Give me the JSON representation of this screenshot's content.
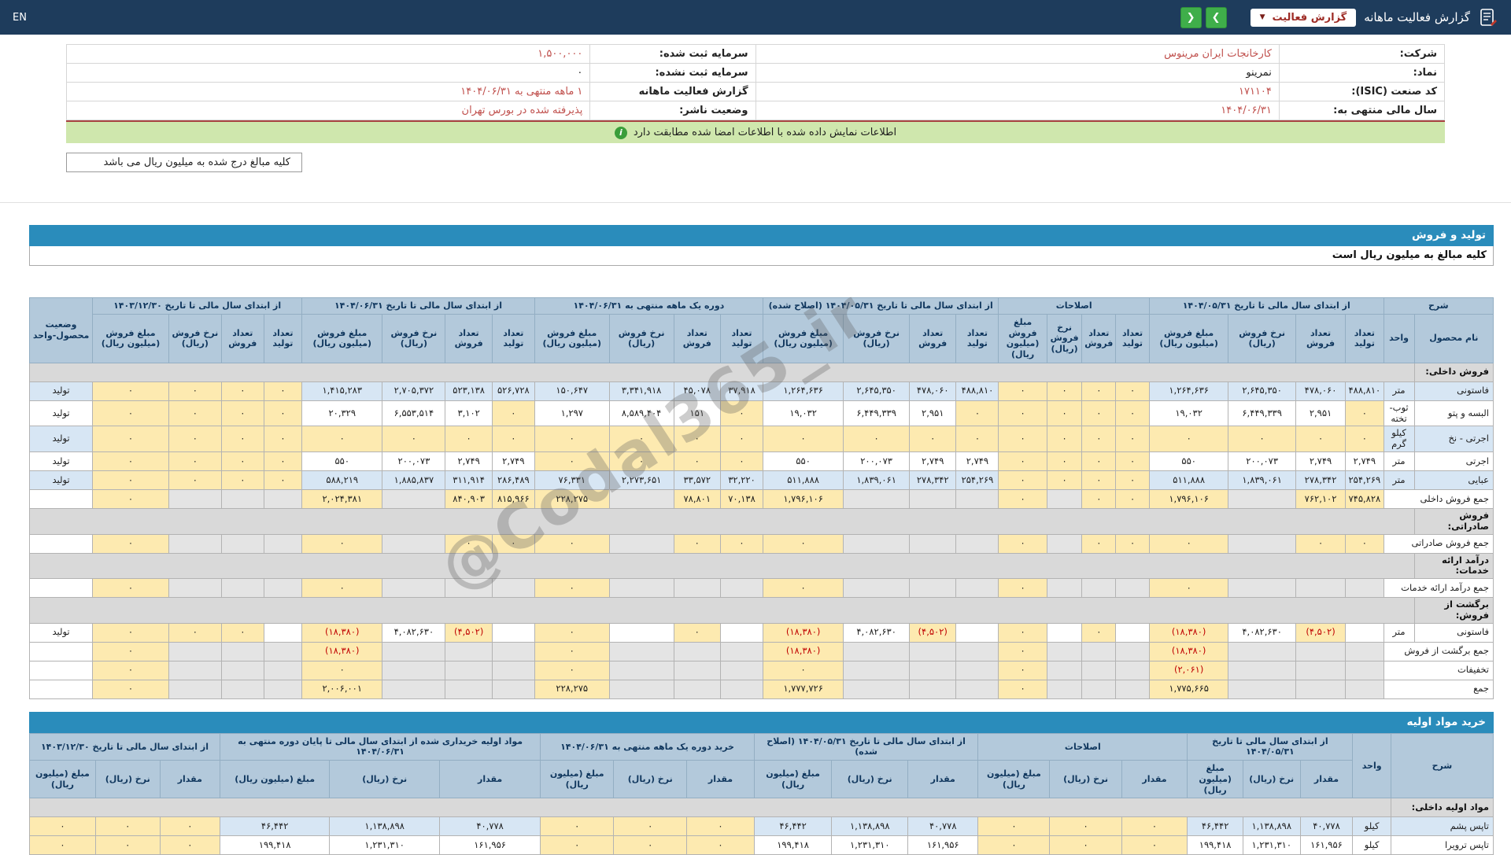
{
  "topbar": {
    "title": "گزارش فعالیت ماهانه",
    "report_select_label": "گزارش فعالیت",
    "caret_icon": "▼",
    "nav_next_icon": "❯",
    "nav_prev_icon": "❮",
    "en_label": "EN"
  },
  "company": {
    "rows": [
      {
        "label_r": "شرکت:",
        "value_r": "کارخانجات ایران مرینوس",
        "label_l": "سرمایه ثبت شده:",
        "value_l": "۱,۵۰۰,۰۰۰"
      },
      {
        "label_r": "نماد:",
        "value_r": "نمرینو",
        "label_l": "سرمایه ثبت نشده:",
        "value_l": "۰"
      },
      {
        "label_r": "کد صنعت (ISIC):",
        "value_r": "۱۷۱۱۰۴",
        "label_l": "گزارش فعالیت ماهانه",
        "value_l": "۱ ماهه منتهی به ۱۴۰۴/۰۶/۳۱"
      },
      {
        "label_r": "سال مالی منتهی به:",
        "value_r": "۱۴۰۴/۰۶/۳۱",
        "label_l": "وضعیت ناشر:",
        "value_l": "پذیرفته شده در بورس تهران"
      }
    ]
  },
  "verify": {
    "text": "اطلاعات نمایش داده شده با اطلاعات امضا شده مطابقت دارد",
    "icon": "i"
  },
  "amounts_note": "کلیه مبالغ درج شده به میلیون ریال می باشد",
  "watermark": "@Codal365_ir",
  "sales": {
    "title": "تولید و فروش",
    "note": "کلیه مبالغ به میلیون ریال است",
    "desc_header": "شرح",
    "name_header": "نام محصول",
    "unit_header": "واحد",
    "status_header": "وضعیت محصول-واحد",
    "groups": [
      "از ابتدای سال مالی تا تاریخ ۱۴۰۴/۰۵/۳۱",
      "اصلاحات",
      "از ابتدای سال مالی تا تاریخ ۱۴۰۴/۰۵/۳۱ (اصلاح شده)",
      "دوره یک ماهه منتهی به ۱۴۰۴/۰۶/۳۱",
      "از ابتدای سال مالی تا تاریخ ۱۴۰۴/۰۶/۳۱",
      "از ابتدای سال مالی تا تاریخ ۱۴۰۳/۱۲/۳۰"
    ],
    "subcols": [
      "تعداد تولید",
      "تعداد فروش",
      "نرخ فروش (ریال)",
      "مبلغ فروش (میلیون ریال)"
    ],
    "rows": [
      {
        "type": "section",
        "name": "فروش داخلی:"
      },
      {
        "type": "data",
        "name": "فاستونی",
        "unit": "متر",
        "status": "تولید",
        "cells": [
          "۴۸۸,۸۱۰",
          "۴۷۸,۰۶۰",
          "۲,۶۴۵,۳۵۰",
          "۱,۲۶۴,۶۳۶",
          "۰",
          "۰",
          "۰",
          "۰",
          "۴۸۸,۸۱۰",
          "۴۷۸,۰۶۰",
          "۲,۶۴۵,۳۵۰",
          "۱,۲۶۴,۶۳۶",
          "۳۷,۹۱۸",
          "۴۵,۰۷۸",
          "۳,۳۴۱,۹۱۸",
          "۱۵۰,۶۴۷",
          "۵۲۶,۷۲۸",
          "۵۲۳,۱۳۸",
          "۲,۷۰۵,۳۷۲",
          "۱,۴۱۵,۲۸۳",
          "۰",
          "۰",
          "۰",
          "۰"
        ]
      },
      {
        "type": "data",
        "name": "البسه و پتو",
        "unit": "ثوب-تخته",
        "status": "تولید",
        "cells": [
          "۰",
          "۲,۹۵۱",
          "۶,۴۴۹,۳۳۹",
          "۱۹,۰۳۲",
          "۰",
          "۰",
          "۰",
          "۰",
          "۰",
          "۲,۹۵۱",
          "۶,۴۴۹,۳۳۹",
          "۱۹,۰۳۲",
          "۰",
          "۱۵۱",
          "۸,۵۸۹,۴۰۴",
          "۱,۲۹۷",
          "۰",
          "۳,۱۰۲",
          "۶,۵۵۳,۵۱۴",
          "۲۰,۳۲۹",
          "۰",
          "۰",
          "۰",
          "۰"
        ]
      },
      {
        "type": "data",
        "name": "اجرتی - نخ",
        "unit": "کیلو گرم",
        "status": "تولید",
        "cells": [
          "۰",
          "۰",
          "۰",
          "۰",
          "۰",
          "۰",
          "۰",
          "۰",
          "۰",
          "۰",
          "۰",
          "۰",
          "۰",
          "۰",
          "۰",
          "۰",
          "۰",
          "۰",
          "۰",
          "۰",
          "۰",
          "۰",
          "۰",
          "۰"
        ]
      },
      {
        "type": "data",
        "name": "اجرتی",
        "unit": "متر",
        "status": "تولید",
        "cells": [
          "۲,۷۴۹",
          "۲,۷۴۹",
          "۲۰۰,۰۷۳",
          "۵۵۰",
          "۰",
          "۰",
          "۰",
          "۰",
          "۲,۷۴۹",
          "۲,۷۴۹",
          "۲۰۰,۰۷۳",
          "۵۵۰",
          "۰",
          "۰",
          "۰",
          "۰",
          "۲,۷۴۹",
          "۲,۷۴۹",
          "۲۰۰,۰۷۳",
          "۵۵۰",
          "۰",
          "۰",
          "۰",
          "۰"
        ]
      },
      {
        "type": "data",
        "name": "عبایی",
        "unit": "متر",
        "status": "تولید",
        "cells": [
          "۲۵۴,۲۶۹",
          "۲۷۸,۳۴۲",
          "۱,۸۳۹,۰۶۱",
          "۵۱۱,۸۸۸",
          "۰",
          "۰",
          "۰",
          "۰",
          "۲۵۴,۲۶۹",
          "۲۷۸,۳۴۲",
          "۱,۸۳۹,۰۶۱",
          "۵۱۱,۸۸۸",
          "۳۲,۲۲۰",
          "۳۳,۵۷۲",
          "۲,۲۷۳,۶۵۱",
          "۷۶,۳۳۱",
          "۲۸۶,۴۸۹",
          "۳۱۱,۹۱۴",
          "۱,۸۸۵,۸۳۷",
          "۵۸۸,۲۱۹",
          "۰",
          "۰",
          "۰",
          "۰"
        ]
      },
      {
        "type": "sum",
        "name": "جمع فروش داخلی",
        "status": "",
        "cells": [
          "۷۴۵,۸۲۸",
          "۷۶۲,۱۰۲",
          "",
          "۱,۷۹۶,۱۰۶",
          "۰",
          "۰",
          "",
          "۰",
          "",
          "",
          "",
          "۱,۷۹۶,۱۰۶",
          "۷۰,۱۳۸",
          "۷۸,۸۰۱",
          "",
          "۲۲۸,۲۷۵",
          "۸۱۵,۹۶۶",
          "۸۴۰,۹۰۳",
          "",
          "۲,۰۲۴,۳۸۱",
          "",
          "",
          "",
          "۰"
        ]
      },
      {
        "type": "section",
        "name": "فروش صادراتی:"
      },
      {
        "type": "sum",
        "name": "جمع فروش صادراتی",
        "status": "",
        "cells": [
          "۰",
          "۰",
          "",
          "۰",
          "۰",
          "۰",
          "",
          "۰",
          "",
          "",
          "",
          "۰",
          "۰",
          "۰",
          "",
          "۰",
          "۰",
          "۰",
          "",
          "۰",
          "",
          "",
          "",
          "۰"
        ]
      },
      {
        "type": "section",
        "name": "درآمد ارائه خدمات:"
      },
      {
        "type": "sum",
        "name": "جمع درآمد ارائه خدمات",
        "status": "",
        "cells": [
          "",
          "",
          "",
          "۰",
          "",
          "",
          "",
          "۰",
          "",
          "",
          "",
          "۰",
          "",
          "",
          "",
          "۰",
          "",
          "",
          "",
          "۰",
          "",
          "",
          "",
          "۰"
        ]
      },
      {
        "type": "section",
        "name": "برگشت از فروش:"
      },
      {
        "type": "data",
        "name": "فاستونی",
        "unit": "متر",
        "status": "تولید",
        "cells": [
          "",
          "(۴,۵۰۲)",
          "۴,۰۸۲,۶۳۰",
          "(۱۸,۳۸۰)",
          "",
          "۰",
          "",
          "۰",
          "",
          "(۴,۵۰۲)",
          "۴,۰۸۲,۶۳۰",
          "(۱۸,۳۸۰)",
          "",
          "۰",
          "",
          "۰",
          "",
          "(۴,۵۰۲)",
          "۴,۰۸۲,۶۳۰",
          "(۱۸,۳۸۰)",
          "",
          "۰",
          "۰",
          "۰"
        ]
      },
      {
        "type": "sum",
        "name": "جمع برگشت از فروش",
        "status": "",
        "cells": [
          "",
          "",
          "",
          "(۱۸,۳۸۰)",
          "",
          "",
          "",
          "۰",
          "",
          "",
          "",
          "(۱۸,۳۸۰)",
          "",
          "",
          "",
          "۰",
          "",
          "",
          "",
          "(۱۸,۳۸۰)",
          "",
          "",
          "",
          "۰"
        ]
      },
      {
        "type": "sum",
        "name": "تخفیفات",
        "status": "",
        "cells": [
          "",
          "",
          "",
          "(۲,۰۶۱)",
          "",
          "",
          "",
          "۰",
          "",
          "",
          "",
          "۰",
          "",
          "",
          "",
          "۰",
          "",
          "",
          "",
          "۰",
          "",
          "",
          "",
          "۰"
        ]
      },
      {
        "type": "sum",
        "name": "جمع",
        "status": "",
        "cells": [
          "",
          "",
          "",
          "۱,۷۷۵,۶۶۵",
          "",
          "",
          "",
          "۰",
          "",
          "",
          "",
          "۱,۷۷۷,۷۲۶",
          "",
          "",
          "",
          "۲۲۸,۲۷۵",
          "",
          "",
          "",
          "۲,۰۰۶,۰۰۱",
          "",
          "",
          "",
          "۰"
        ]
      }
    ]
  },
  "materials": {
    "title": "خرید مواد اولیه",
    "desc_header": "شرح",
    "unit_header": "واحد",
    "groups": [
      "از ابتدای سال مالی تا تاریخ ۱۴۰۴/۰۵/۳۱",
      "اصلاحات",
      "از ابتدای سال مالی تا تاریخ ۱۴۰۴/۰۵/۳۱ (اصلاح شده)",
      "خرید دوره یک ماهه منتهی به ۱۴۰۴/۰۶/۳۱",
      "مواد اولیه خریداری شده از ابتدای سال مالی تا پایان دوره منتهی به ۱۴۰۴/۰۶/۳۱",
      "از ابتدای سال مالی تا تاریخ ۱۴۰۳/۱۲/۳۰"
    ],
    "subcols": [
      "مقدار",
      "نرخ (ریال)",
      "مبلغ (میلیون ریال)"
    ],
    "rows": [
      {
        "type": "section",
        "name": "مواد اولیه داخلی:"
      },
      {
        "type": "data",
        "name": "تاپس پشم",
        "unit": "کیلو",
        "cells": [
          "۴۰,۷۷۸",
          "۱,۱۳۸,۸۹۸",
          "۴۶,۴۴۲",
          "۰",
          "۰",
          "۰",
          "۴۰,۷۷۸",
          "۱,۱۳۸,۸۹۸",
          "۴۶,۴۴۲",
          "۰",
          "۰",
          "۰",
          "۴۰,۷۷۸",
          "۱,۱۳۸,۸۹۸",
          "۴۶,۴۴۲",
          "۰",
          "۰",
          "۰"
        ]
      },
      {
        "type": "data",
        "name": "تاپس ترویرا",
        "unit": "کیلو",
        "cells": [
          "۱۶۱,۹۵۶",
          "۱,۲۳۱,۳۱۰",
          "۱۹۹,۴۱۸",
          "۰",
          "۰",
          "۰",
          "۱۶۱,۹۵۶",
          "۱,۲۳۱,۳۱۰",
          "۱۹۹,۴۱۸",
          "۰",
          "۰",
          "۰",
          "۱۶۱,۹۵۶",
          "۱,۲۳۱,۳۱۰",
          "۱۹۹,۴۱۸",
          "۰",
          "۰",
          "۰"
        ]
      }
    ]
  }
}
